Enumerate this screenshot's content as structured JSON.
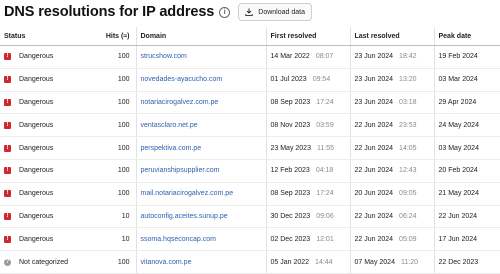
{
  "header": {
    "title": "DNS resolutions for IP address",
    "info_glyph": "i",
    "download_label": "Download data"
  },
  "columns": {
    "status": "Status",
    "hits": "Hits (≈)",
    "domain": "Domain",
    "first_resolved": "First resolved",
    "last_resolved": "Last resolved",
    "peak_date": "Peak date"
  },
  "status_colors": {
    "dangerous": "#d0282e",
    "not_categorized": "#9a9a9a"
  },
  "rows": [
    {
      "status": "Dangerous",
      "status_icon": "danger-icon",
      "glyph": "!",
      "hits": "100",
      "domain": "strucshow.com",
      "first_date": "14 Mar 2022",
      "first_time": "08:07",
      "last_date": "23 Jun 2024",
      "last_time": "18:42",
      "peak": "19 Feb 2024"
    },
    {
      "status": "Dangerous",
      "status_icon": "danger-icon",
      "glyph": "!",
      "hits": "100",
      "domain": "novedades-ayacucho.com",
      "first_date": "01 Jul 2023",
      "first_time": "09:54",
      "last_date": "23 Jun 2024",
      "last_time": "13:20",
      "peak": "03 Mar 2024"
    },
    {
      "status": "Dangerous",
      "status_icon": "danger-icon",
      "glyph": "!",
      "hits": "100",
      "domain": "notariacirogalvez.com.pe",
      "first_date": "08 Sep 2023",
      "first_time": "17:24",
      "last_date": "23 Jun 2024",
      "last_time": "03:18",
      "peak": "29 Apr 2024"
    },
    {
      "status": "Dangerous",
      "status_icon": "danger-icon",
      "glyph": "!",
      "hits": "100",
      "domain": "ventasclaro.net.pe",
      "first_date": "08 Nov 2023",
      "first_time": "03:59",
      "last_date": "22 Jun 2024",
      "last_time": "23:53",
      "peak": "24 May 2024"
    },
    {
      "status": "Dangerous",
      "status_icon": "danger-icon",
      "glyph": "!",
      "hits": "100",
      "domain": "perspektiva.com.pe",
      "first_date": "23 May 2023",
      "first_time": "11:55",
      "last_date": "22 Jun 2024",
      "last_time": "14:05",
      "peak": "03 May 2024"
    },
    {
      "status": "Dangerous",
      "status_icon": "danger-icon",
      "glyph": "!",
      "hits": "100",
      "domain": "peruvianshipsupplier.com",
      "first_date": "12 Feb 2023",
      "first_time": "04:18",
      "last_date": "22 Jun 2024",
      "last_time": "12:43",
      "peak": "20 Feb 2024"
    },
    {
      "status": "Dangerous",
      "status_icon": "danger-icon",
      "glyph": "!",
      "hits": "100",
      "domain": "mail.notariacirogalvez.com.pe",
      "first_date": "08 Sep 2023",
      "first_time": "17:24",
      "last_date": "20 Jun 2024",
      "last_time": "09:05",
      "peak": "21 May 2024"
    },
    {
      "status": "Dangerous",
      "status_icon": "danger-icon",
      "glyph": "!",
      "hits": "10",
      "domain": "autoconfig.aceites.sunup.pe",
      "first_date": "30 Dec 2023",
      "first_time": "09:06",
      "last_date": "22 Jun 2024",
      "last_time": "06:24",
      "peak": "22 Jun 2024"
    },
    {
      "status": "Dangerous",
      "status_icon": "danger-icon",
      "glyph": "!",
      "hits": "10",
      "domain": "ssoma.hqseconcap.com",
      "first_date": "02 Dec 2023",
      "first_time": "12:01",
      "last_date": "22 Jun 2024",
      "last_time": "05:09",
      "peak": "17 Jun 2024"
    },
    {
      "status": "Not categorized",
      "status_icon": "not-categorized-icon",
      "glyph": "?",
      "hits": "100",
      "domain": "vitanova.com.pe",
      "first_date": "05 Jan 2022",
      "first_time": "14:44",
      "last_date": "07 May 2024",
      "last_time": "11:20",
      "peak": "22 Dec 2023"
    }
  ]
}
